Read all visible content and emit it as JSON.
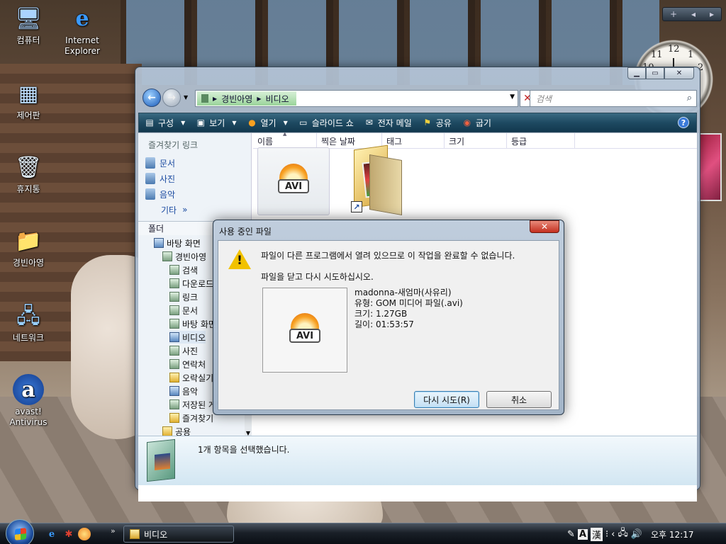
{
  "desktop": {
    "icons": [
      {
        "label": "컴퓨터",
        "icon": "computer-icon"
      },
      {
        "label": "Internet Explorer",
        "icon": "internet-explorer-icon"
      },
      {
        "label": "제어판",
        "icon": "control-panel-icon"
      },
      {
        "label": "휴지통",
        "icon": "recycle-bin-icon"
      },
      {
        "label": "경빈아영",
        "icon": "user-folder-icon"
      },
      {
        "label": "네트워크",
        "icon": "network-icon"
      },
      {
        "label": "avast! Antivirus",
        "icon": "avast-icon"
      }
    ]
  },
  "sidebar": {
    "clock_numbers": [
      "12",
      "1",
      "2",
      "10",
      "11"
    ]
  },
  "explorer": {
    "address": {
      "crumb1": "경빈아영",
      "crumb2": "비디오"
    },
    "search_placeholder": "검색",
    "toolbar": {
      "organize": "구성",
      "views": "보기",
      "open": "열기",
      "slideshow": "슬라이드 쇼",
      "email": "전자 메일",
      "share": "공유",
      "burn": "굽기"
    },
    "favorites_title": "즐겨찾기 링크",
    "favorites": [
      "문서",
      "사진",
      "음악"
    ],
    "favorites_more": "기타",
    "folders_title": "폴더",
    "tree": {
      "desktop": "바탕 화면",
      "user": "경빈아영",
      "items": [
        "검색",
        "다운로드",
        "링크",
        "문서",
        "바탕 화면",
        "비디오",
        "사진",
        "연락처",
        "오락실기",
        "음악",
        "저장된 게임",
        "즐겨찾기"
      ],
      "public": "공용"
    },
    "columns": [
      "이름",
      "찍은 날짜",
      "태그",
      "크기",
      "등급"
    ],
    "file_avi_label": "AVI",
    "status": "1개 항목을 선택했습니다."
  },
  "dialog": {
    "title": "사용 중인 파일",
    "message": "파일이 다른 프로그램에서 열려 있으므로 이 작업을 완료할 수 없습니다.",
    "hint": "파일을 닫고 다시 시도하십시오.",
    "file_name": "madonna-새엄마(사유리)",
    "file_type": "유형: GOM 미디어 파일(.avi)",
    "file_size": "크기: 1.27GB",
    "file_length": "길이: 01:53:57",
    "retry": "다시 시도(R)",
    "cancel": "취소",
    "thumb_label": "AVI"
  },
  "taskbar": {
    "task_label": "비디오",
    "time": "오후 12:17",
    "ime_a": "A",
    "ime_han": "漢"
  },
  "colors": {
    "toolbar": "#1e4a62",
    "link": "#1a4aa0",
    "warning": "#f2c200"
  }
}
